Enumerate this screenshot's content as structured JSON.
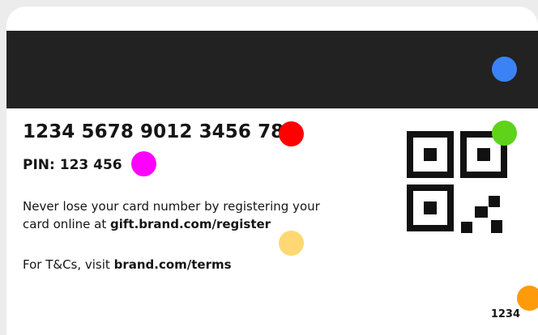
{
  "card": {
    "number": "1234 5678 9012 3456 789",
    "pin_label": "PIN:",
    "pin_value": "123 456",
    "register_line1": "Never lose your card number by registering your",
    "register_line2_prefix": "card online at ",
    "register_link": "gift.brand.com/register",
    "terms_prefix": "For T&Cs, visit ",
    "terms_link": "brand.com/terms",
    "card_id": "1234"
  },
  "colors": {
    "stripe": "#222222",
    "qr": "#111111",
    "dot_red": "#ff0000",
    "dot_magenta": "#ff00ff",
    "dot_blue": "#3b82f6",
    "dot_green": "#5fd21a",
    "dot_yellow": "#ffd873",
    "dot_orange": "#ff9a0a"
  },
  "markers": [
    "red-dot",
    "magenta-dot",
    "blue-dot",
    "green-dot",
    "yellow-dot",
    "orange-dot"
  ]
}
